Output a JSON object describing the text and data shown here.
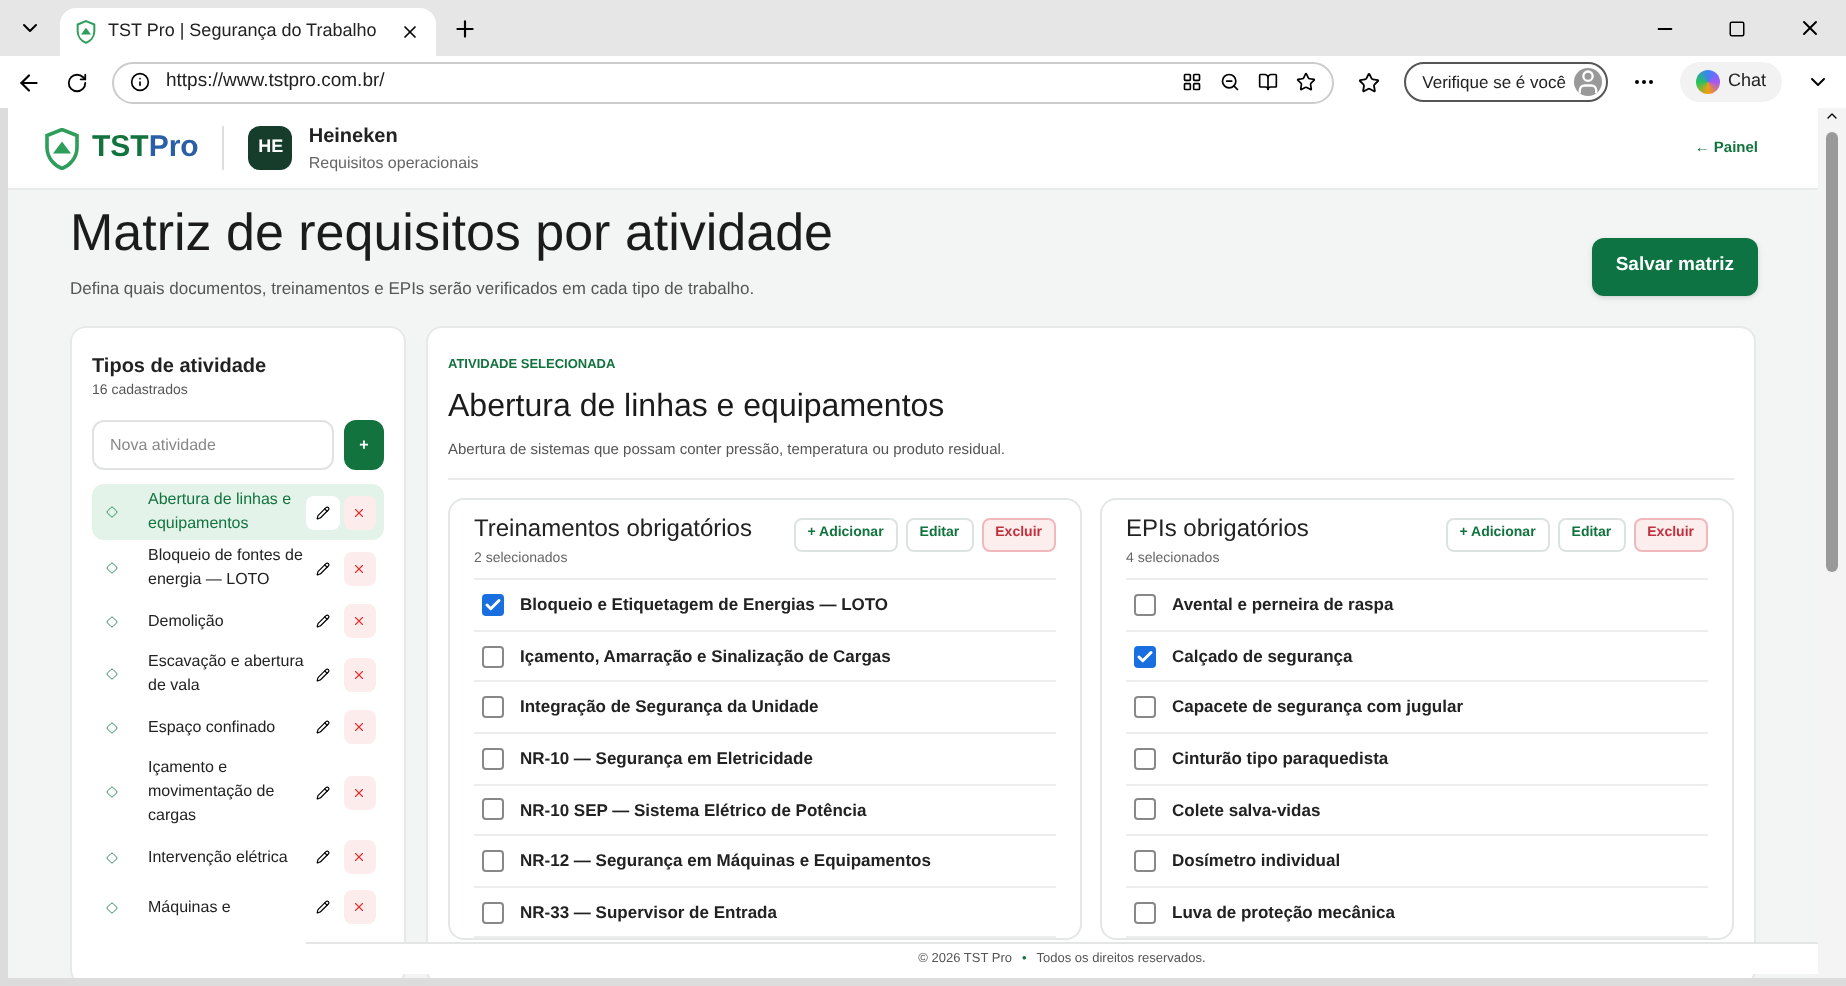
{
  "browser": {
    "tab_title": "TST Pro | Segurança do Trabalho",
    "url": "https://www.tstpro.com.br/",
    "profile_button": "Verifique se é você",
    "chat_button": "Chat"
  },
  "header": {
    "logo_text_a": "TST",
    "logo_text_b": "Pro",
    "org_initials": "HE",
    "org_name": "Heineken",
    "org_subtitle": "Requisitos operacionais",
    "back_link": "← Painel"
  },
  "page": {
    "title": "Matriz de requisitos por atividade",
    "subtitle": "Defina quais documentos, treinamentos e EPIs serão verificados em cada tipo de trabalho.",
    "save_button": "Salvar matriz"
  },
  "sidebar": {
    "title": "Tipos de atividade",
    "count": "16 cadastrados",
    "new_placeholder": "Nova atividade",
    "add_button": "+",
    "items": [
      {
        "label": "Abertura de linhas e equipamentos",
        "selected": true
      },
      {
        "label": "Bloqueio de fontes de energia — LOTO",
        "selected": false
      },
      {
        "label": "Demolição",
        "selected": false
      },
      {
        "label": "Escavação e abertura de vala",
        "selected": false
      },
      {
        "label": "Espaço confinado",
        "selected": false
      },
      {
        "label": "Içamento e movimentação de cargas",
        "selected": false
      },
      {
        "label": "Intervenção elétrica",
        "selected": false
      },
      {
        "label": "Máquinas e",
        "selected": false
      }
    ]
  },
  "selected_activity": {
    "eyebrow": "ATIVIDADE SELECIONADA",
    "title": "Abertura de linhas e equipamentos",
    "description": "Abertura de sistemas que possam conter pressão, temperatura ou produto residual."
  },
  "panels": [
    {
      "title": "Treinamentos obrigatórios",
      "count": "2 selecionados",
      "add": "+ Adicionar",
      "edit": "Editar",
      "delete": "Excluir",
      "items": [
        {
          "label": "Bloqueio e Etiquetagem de Energias — LOTO",
          "checked": true
        },
        {
          "label": "Içamento, Amarração e Sinalização de Cargas",
          "checked": false
        },
        {
          "label": "Integração de Segurança da Unidade",
          "checked": false
        },
        {
          "label": "NR-10 — Segurança em Eletricidade",
          "checked": false
        },
        {
          "label": "NR-10 SEP — Sistema Elétrico de Potência",
          "checked": false
        },
        {
          "label": "NR-12 — Segurança em Máquinas e Equipamentos",
          "checked": false
        },
        {
          "label": "NR-33 — Supervisor de Entrada",
          "checked": false
        }
      ]
    },
    {
      "title": "EPIs obrigatórios",
      "count": "4 selecionados",
      "add": "+ Adicionar",
      "edit": "Editar",
      "delete": "Excluir",
      "items": [
        {
          "label": "Avental e perneira de raspa",
          "checked": false
        },
        {
          "label": "Calçado de segurança",
          "checked": true
        },
        {
          "label": "Capacete de segurança com jugular",
          "checked": false
        },
        {
          "label": "Cinturão tipo paraquedista",
          "checked": false
        },
        {
          "label": "Colete salva-vidas",
          "checked": false
        },
        {
          "label": "Dosímetro individual",
          "checked": false
        },
        {
          "label": "Luva de proteção mecânica",
          "checked": false
        }
      ]
    }
  ],
  "footer": {
    "copyright": "© 2026 TST Pro",
    "separator": "•",
    "rights": "Todos os direitos reservados."
  }
}
